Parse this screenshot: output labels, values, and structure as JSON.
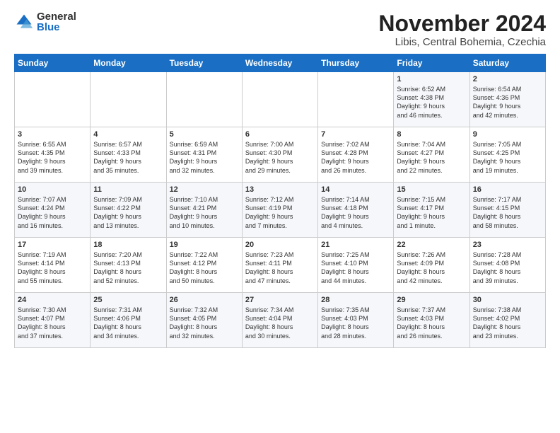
{
  "logo": {
    "general": "General",
    "blue": "Blue"
  },
  "header": {
    "month": "November 2024",
    "location": "Libis, Central Bohemia, Czechia"
  },
  "weekdays": [
    "Sunday",
    "Monday",
    "Tuesday",
    "Wednesday",
    "Thursday",
    "Friday",
    "Saturday"
  ],
  "weeks": [
    [
      {
        "day": "",
        "info": ""
      },
      {
        "day": "",
        "info": ""
      },
      {
        "day": "",
        "info": ""
      },
      {
        "day": "",
        "info": ""
      },
      {
        "day": "",
        "info": ""
      },
      {
        "day": "1",
        "info": "Sunrise: 6:52 AM\nSunset: 4:38 PM\nDaylight: 9 hours\nand 46 minutes."
      },
      {
        "day": "2",
        "info": "Sunrise: 6:54 AM\nSunset: 4:36 PM\nDaylight: 9 hours\nand 42 minutes."
      }
    ],
    [
      {
        "day": "3",
        "info": "Sunrise: 6:55 AM\nSunset: 4:35 PM\nDaylight: 9 hours\nand 39 minutes."
      },
      {
        "day": "4",
        "info": "Sunrise: 6:57 AM\nSunset: 4:33 PM\nDaylight: 9 hours\nand 35 minutes."
      },
      {
        "day": "5",
        "info": "Sunrise: 6:59 AM\nSunset: 4:31 PM\nDaylight: 9 hours\nand 32 minutes."
      },
      {
        "day": "6",
        "info": "Sunrise: 7:00 AM\nSunset: 4:30 PM\nDaylight: 9 hours\nand 29 minutes."
      },
      {
        "day": "7",
        "info": "Sunrise: 7:02 AM\nSunset: 4:28 PM\nDaylight: 9 hours\nand 26 minutes."
      },
      {
        "day": "8",
        "info": "Sunrise: 7:04 AM\nSunset: 4:27 PM\nDaylight: 9 hours\nand 22 minutes."
      },
      {
        "day": "9",
        "info": "Sunrise: 7:05 AM\nSunset: 4:25 PM\nDaylight: 9 hours\nand 19 minutes."
      }
    ],
    [
      {
        "day": "10",
        "info": "Sunrise: 7:07 AM\nSunset: 4:24 PM\nDaylight: 9 hours\nand 16 minutes."
      },
      {
        "day": "11",
        "info": "Sunrise: 7:09 AM\nSunset: 4:22 PM\nDaylight: 9 hours\nand 13 minutes."
      },
      {
        "day": "12",
        "info": "Sunrise: 7:10 AM\nSunset: 4:21 PM\nDaylight: 9 hours\nand 10 minutes."
      },
      {
        "day": "13",
        "info": "Sunrise: 7:12 AM\nSunset: 4:19 PM\nDaylight: 9 hours\nand 7 minutes."
      },
      {
        "day": "14",
        "info": "Sunrise: 7:14 AM\nSunset: 4:18 PM\nDaylight: 9 hours\nand 4 minutes."
      },
      {
        "day": "15",
        "info": "Sunrise: 7:15 AM\nSunset: 4:17 PM\nDaylight: 9 hours\nand 1 minute."
      },
      {
        "day": "16",
        "info": "Sunrise: 7:17 AM\nSunset: 4:15 PM\nDaylight: 8 hours\nand 58 minutes."
      }
    ],
    [
      {
        "day": "17",
        "info": "Sunrise: 7:19 AM\nSunset: 4:14 PM\nDaylight: 8 hours\nand 55 minutes."
      },
      {
        "day": "18",
        "info": "Sunrise: 7:20 AM\nSunset: 4:13 PM\nDaylight: 8 hours\nand 52 minutes."
      },
      {
        "day": "19",
        "info": "Sunrise: 7:22 AM\nSunset: 4:12 PM\nDaylight: 8 hours\nand 50 minutes."
      },
      {
        "day": "20",
        "info": "Sunrise: 7:23 AM\nSunset: 4:11 PM\nDaylight: 8 hours\nand 47 minutes."
      },
      {
        "day": "21",
        "info": "Sunrise: 7:25 AM\nSunset: 4:10 PM\nDaylight: 8 hours\nand 44 minutes."
      },
      {
        "day": "22",
        "info": "Sunrise: 7:26 AM\nSunset: 4:09 PM\nDaylight: 8 hours\nand 42 minutes."
      },
      {
        "day": "23",
        "info": "Sunrise: 7:28 AM\nSunset: 4:08 PM\nDaylight: 8 hours\nand 39 minutes."
      }
    ],
    [
      {
        "day": "24",
        "info": "Sunrise: 7:30 AM\nSunset: 4:07 PM\nDaylight: 8 hours\nand 37 minutes."
      },
      {
        "day": "25",
        "info": "Sunrise: 7:31 AM\nSunset: 4:06 PM\nDaylight: 8 hours\nand 34 minutes."
      },
      {
        "day": "26",
        "info": "Sunrise: 7:32 AM\nSunset: 4:05 PM\nDaylight: 8 hours\nand 32 minutes."
      },
      {
        "day": "27",
        "info": "Sunrise: 7:34 AM\nSunset: 4:04 PM\nDaylight: 8 hours\nand 30 minutes."
      },
      {
        "day": "28",
        "info": "Sunrise: 7:35 AM\nSunset: 4:03 PM\nDaylight: 8 hours\nand 28 minutes."
      },
      {
        "day": "29",
        "info": "Sunrise: 7:37 AM\nSunset: 4:03 PM\nDaylight: 8 hours\nand 26 minutes."
      },
      {
        "day": "30",
        "info": "Sunrise: 7:38 AM\nSunset: 4:02 PM\nDaylight: 8 hours\nand 23 minutes."
      }
    ]
  ]
}
